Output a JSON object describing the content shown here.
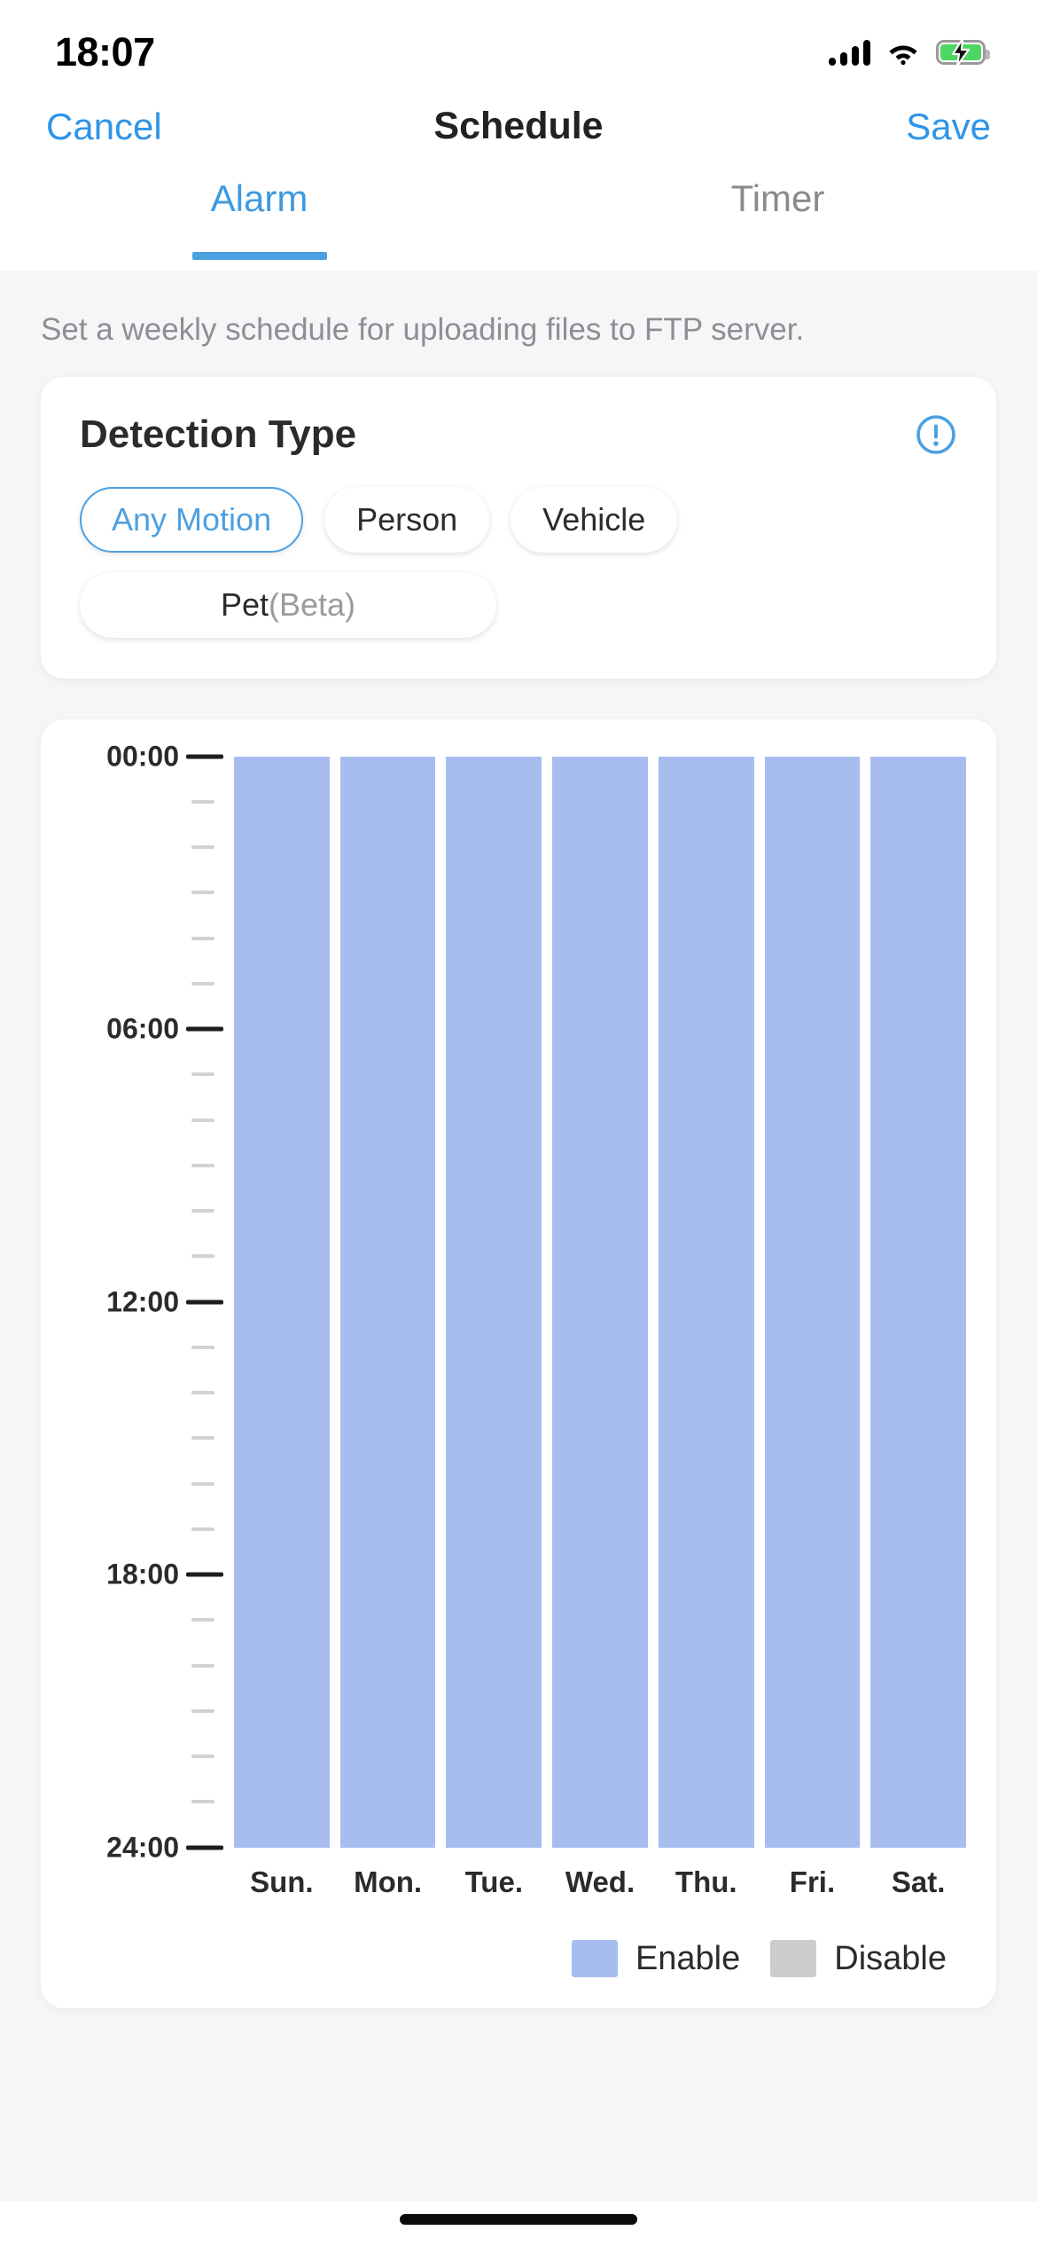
{
  "status_bar": {
    "time": "18:07",
    "signal_icon": "cellular-signal-icon",
    "wifi_icon": "wifi-icon",
    "battery_icon": "battery-charging-icon"
  },
  "nav": {
    "cancel_label": "Cancel",
    "title": "Schedule",
    "save_label": "Save"
  },
  "tabs": [
    {
      "label": "Alarm",
      "active": true
    },
    {
      "label": "Timer",
      "active": false
    }
  ],
  "hint": "Set a weekly schedule for uploading files to FTP server.",
  "detection_card": {
    "title": "Detection Type",
    "info_icon": "info-circle-icon",
    "chips": [
      {
        "label": "Any Motion",
        "selected": true
      },
      {
        "label": "Person",
        "selected": false
      },
      {
        "label": "Vehicle",
        "selected": false
      },
      {
        "label": "Pet",
        "suffix": "(Beta)",
        "selected": false
      }
    ]
  },
  "legend": [
    {
      "label": "Enable",
      "color": "#a8bdef"
    },
    {
      "label": "Disable",
      "color": "#cccccc"
    }
  ],
  "colors": {
    "accent": "#4da0e0",
    "enable_bar": "#a8bdef",
    "disable_bar": "#cccccc",
    "page_background": "#f5f6f8",
    "card_background": "#ffffff"
  },
  "chart_data": {
    "type": "bar",
    "title": "",
    "xlabel": "",
    "ylabel": "",
    "orientation": "vertical-time",
    "categories": [
      "Sun.",
      "Mon.",
      "Tue.",
      "Wed.",
      "Thu.",
      "Fri.",
      "Sat."
    ],
    "y_axis_labels": [
      "00:00",
      "06:00",
      "12:00",
      "18:00",
      "24:00"
    ],
    "y_axis_major_values": [
      0,
      6,
      12,
      18,
      24
    ],
    "y_minor_tick_interval_hours": 1,
    "ylim": [
      0,
      24
    ],
    "grid": false,
    "legend_position": "bottom-right",
    "series": [
      {
        "name": "Enable",
        "color": "#a8bdef",
        "values": [
          24,
          24,
          24,
          24,
          24,
          24,
          24
        ]
      },
      {
        "name": "Disable",
        "color": "#cccccc",
        "values": [
          0,
          0,
          0,
          0,
          0,
          0,
          0
        ]
      }
    ],
    "segments": [
      {
        "day": "Sun.",
        "start": "00:00",
        "end": "24:00",
        "state": "Enable"
      },
      {
        "day": "Mon.",
        "start": "00:00",
        "end": "24:00",
        "state": "Enable"
      },
      {
        "day": "Tue.",
        "start": "00:00",
        "end": "24:00",
        "state": "Enable"
      },
      {
        "day": "Wed.",
        "start": "00:00",
        "end": "24:00",
        "state": "Enable"
      },
      {
        "day": "Thu.",
        "start": "00:00",
        "end": "24:00",
        "state": "Enable"
      },
      {
        "day": "Fri.",
        "start": "00:00",
        "end": "24:00",
        "state": "Enable"
      },
      {
        "day": "Sat.",
        "start": "00:00",
        "end": "24:00",
        "state": "Enable"
      }
    ]
  }
}
